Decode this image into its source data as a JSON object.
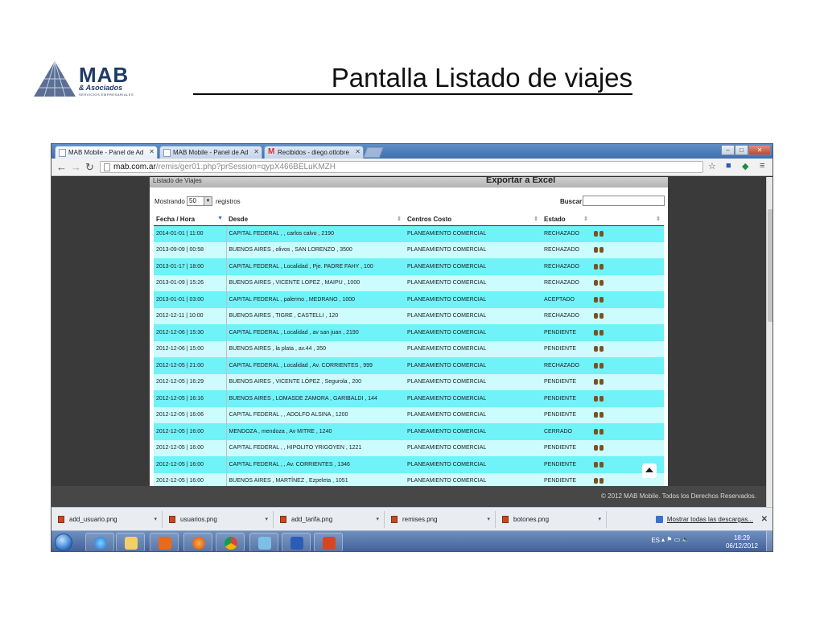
{
  "slide": {
    "title": "Pantalla Listado de viajes",
    "logo": {
      "brand": "MAB",
      "sub": "& Asociados",
      "tagline": "SERVICIOS EMPRESARIALES"
    }
  },
  "browser": {
    "tabs": [
      {
        "label": "MAB Mobile - Panel de Ad",
        "active": true,
        "icon": "page-icon"
      },
      {
        "label": "MAB Mobile - Panel de Ad",
        "active": false,
        "icon": "page-icon"
      },
      {
        "label": "Recibidos - diego.ottobre",
        "active": false,
        "icon": "gmail-icon"
      }
    ],
    "url_host": "mab.com.ar",
    "url_path": "/remis/ger01.php?prSession=qypX466BELuKMZH"
  },
  "page": {
    "panel_title": "Listado de Viajes",
    "export_label": "Exportar a Excel",
    "show_prefix": "Mostrando",
    "page_size": "50",
    "show_suffix": "registros",
    "search_label": "Buscar:",
    "search_value": "",
    "footer": "© 2012 MAB Mobile. Todos los Derechos Reservados."
  },
  "table": {
    "headers": [
      "Fecha / Hora",
      "Desde",
      "Centros Costo",
      "Estado",
      ""
    ],
    "rows": [
      [
        "2014-01-01 | 11:00",
        "CAPITAL FEDERAL , , carlos calvo , 2190",
        "PLANEAMIENTO COMERCIAL",
        "RECHAZADO"
      ],
      [
        "2013-09-09 | 00:58",
        "BUENOS AIRES , olivos , SAN LORENZO , 3500",
        "PLANEAMIENTO COMERCIAL",
        "RECHAZADO"
      ],
      [
        "2013-01-17 | 18:00",
        "CAPITAL FEDERAL , Localidad , Pje. PADRE FAHY , 100",
        "PLANEAMIENTO COMERCIAL",
        "RECHAZADO"
      ],
      [
        "2013-01-09 | 15:26",
        "BUENOS AIRES , VICENTE LOPEZ , MAIPU , 1000",
        "PLANEAMIENTO COMERCIAL",
        "RECHAZADO"
      ],
      [
        "2013-01-01 | 03:00",
        "CAPITAL FEDERAL , palermo , MEDRANO , 1000",
        "PLANEAMIENTO COMERCIAL",
        "ACEPTADO"
      ],
      [
        "2012-12-11 | 10:00",
        "BUENOS AIRES , TIGRE , CASTELLI , 120",
        "PLANEAMIENTO COMERCIAL",
        "RECHAZADO"
      ],
      [
        "2012-12-06 | 15:30",
        "CAPITAL FEDERAL , Localidad , av san juan , 2190",
        "PLANEAMIENTO COMERCIAL",
        "PENDIENTE"
      ],
      [
        "2012-12-06 | 15:00",
        "BUENOS AIRES , la plata , av.44 , 350",
        "PLANEAMIENTO COMERCIAL",
        "PENDIENTE"
      ],
      [
        "2012-12-05 | 21:00",
        "CAPITAL FEDERAL , Localidad , Av. CORRIENTES , 999",
        "PLANEAMIENTO COMERCIAL",
        "RECHAZADO"
      ],
      [
        "2012-12-05 | 16:29",
        "BUENOS AIRES , VICENTE LÓPEZ , Segurola , 200",
        "PLANEAMIENTO COMERCIAL",
        "PENDIENTE"
      ],
      [
        "2012-12-05 | 16:16",
        "BUENOS AIRES , LOMASDE ZAMORA , GARIBALDI , 144",
        "PLANEAMIENTO COMERCIAL",
        "PENDIENTE"
      ],
      [
        "2012-12-05 | 16:06",
        "CAPITAL FEDERAL , , ADOLFO ALSINA , 1200",
        "PLANEAMIENTO COMERCIAL",
        "PENDIENTE"
      ],
      [
        "2012-12-05 | 16:00",
        "MENDOZA , mendoza , Av MITRE , 1240",
        "PLANEAMIENTO COMERCIAL",
        "CERRADO"
      ],
      [
        "2012-12-05 | 16:00",
        "CAPITAL FEDERAL , , HIPOLITO YRIGOYEN , 1221",
        "PLANEAMIENTO COMERCIAL",
        "PENDIENTE"
      ],
      [
        "2012-12-05 | 16:00",
        "CAPITAL FEDERAL , , Av. CORRIENTES , 1346",
        "PLANEAMIENTO COMERCIAL",
        "PENDIENTE"
      ],
      [
        "2012-12-05 | 16:00",
        "BUENOS AIRES , MARTÍNEZ , Ezpeleta , 1051",
        "PLANEAMIENTO COMERCIAL",
        "PENDIENTE"
      ]
    ]
  },
  "downloads": {
    "items": [
      "add_usuario.png",
      "usuarios.png",
      "add_tarifa.png",
      "remises.png",
      "botones.png"
    ],
    "show_all": "Mostrar todas las descargas..."
  },
  "taskbar": {
    "lang": "ES",
    "time": "18:29",
    "date": "06/12/2012",
    "apps": [
      "ie-icon",
      "explorer-icon",
      "media-player-icon",
      "firefox-icon",
      "chrome-icon",
      "app-icon",
      "word-icon",
      "presentation-icon"
    ]
  },
  "colors": {
    "row_odd": "#6ff2f8",
    "row_even": "#ccfcfe",
    "title_brand": "#1f3a66"
  }
}
